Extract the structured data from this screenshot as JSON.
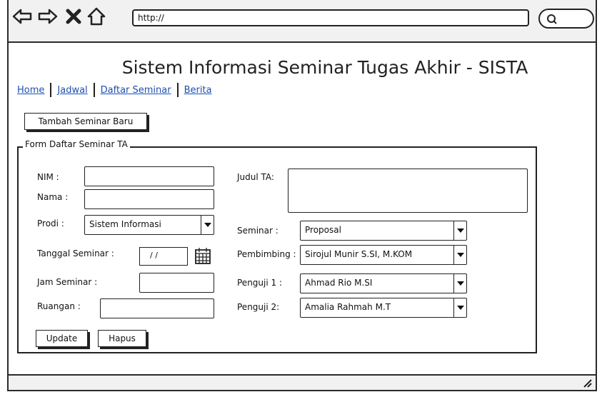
{
  "browser": {
    "address": "http://"
  },
  "page": {
    "title": "Sistem Informasi Seminar Tugas Akhir - SISTA"
  },
  "menu": {
    "items": [
      "Home",
      "Jadwal",
      "Daftar Seminar",
      "Berita"
    ]
  },
  "actions": {
    "add_label": "Tambah Seminar Baru",
    "update_label": "Update",
    "delete_label": "Hapus"
  },
  "form": {
    "legend": "Form Daftar Seminar TA",
    "nim_label": "NIM   :",
    "nama_label": "Nama :",
    "prodi_label": "Prodi  :",
    "prodi_value": "Sistem Informasi",
    "tanggal_label": "Tanggal Seminar :",
    "tanggal_value": "/ /",
    "jam_label": "Jam Seminar :",
    "ruangan_label": "Ruangan :",
    "judul_label": "Judul TA:",
    "seminar_label": "Seminar :",
    "seminar_value": "Proposal",
    "pembimbing_label": "Pembimbing :",
    "pembimbing_value": "Sirojul Munir S.SI, M.KOM",
    "penguji1_label": "Penguji 1 :",
    "penguji1_value": "Ahmad Rio M.SI",
    "penguji2_label": "Penguji 2:",
    "penguji2_value": "Amalia Rahmah M.T"
  },
  "icons": [
    "back-icon",
    "forward-icon",
    "close-icon",
    "home-icon",
    "search-icon",
    "calendar-icon",
    "resize-icon"
  ]
}
